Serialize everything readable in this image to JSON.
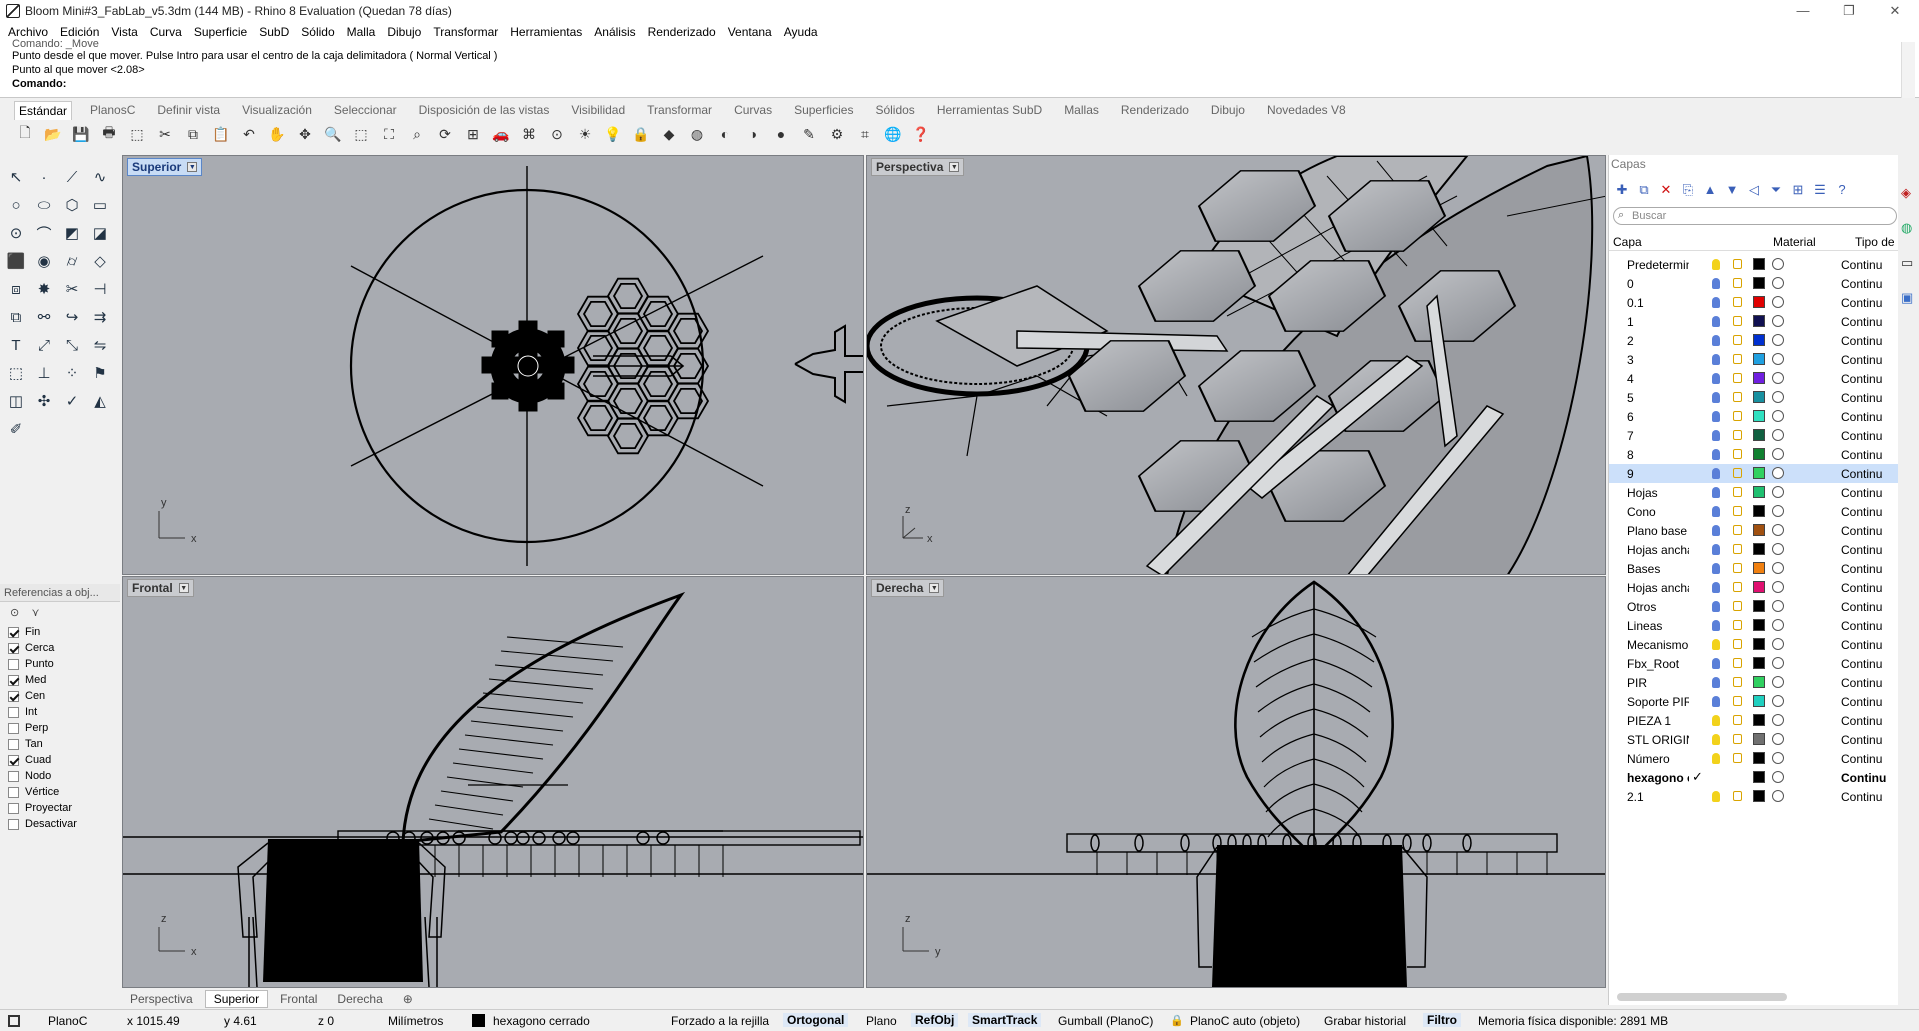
{
  "window": {
    "title": "Bloom Mini#3_FabLab_v5.3dm (144 MB) - Rhino 8 Evaluation (Quedan 78 días)"
  },
  "menu": [
    "Archivo",
    "Edición",
    "Vista",
    "Curva",
    "Superficie",
    "SubD",
    "Sólido",
    "Malla",
    "Dibujo",
    "Transformar",
    "Herramientas",
    "Análisis",
    "Renderizado",
    "Ventana",
    "Ayuda"
  ],
  "command": {
    "history": [
      "Comando: _Move",
      "Punto desde el que mover. Pulse Intro para usar el centro de la caja delimitadora ( Normal  Vertical )",
      "Punto al que mover <2.08>"
    ],
    "prompt": "Comando:"
  },
  "toolbar_tabs": [
    "Estándar",
    "PlanosC",
    "Definir vista",
    "Visualización",
    "Seleccionar",
    "Disposición de las vistas",
    "Visibilidad",
    "Transformar",
    "Curvas",
    "Superficies",
    "Sólidos",
    "Herramientas SubD",
    "Mallas",
    "Renderizado",
    "Dibujo",
    "Novedades V8"
  ],
  "active_tab": "Estándar",
  "viewports": {
    "top": "Superior",
    "perspective": "Perspectiva",
    "front": "Frontal",
    "right": "Derecha"
  },
  "view_tabs": [
    "Perspectiva",
    "Superior",
    "Frontal",
    "Derecha"
  ],
  "active_view_tab": "Superior",
  "osnap": {
    "title": "Referencias a obj...",
    "items": [
      {
        "label": "Fin",
        "checked": true
      },
      {
        "label": "Cerca",
        "checked": true
      },
      {
        "label": "Punto",
        "checked": false
      },
      {
        "label": "Med",
        "checked": true
      },
      {
        "label": "Cen",
        "checked": true
      },
      {
        "label": "Int",
        "checked": false
      },
      {
        "label": "Perp",
        "checked": false
      },
      {
        "label": "Tan",
        "checked": false
      },
      {
        "label": "Cuad",
        "checked": true
      },
      {
        "label": "Nodo",
        "checked": false
      },
      {
        "label": "Vértice",
        "checked": false
      },
      {
        "label": "Proyectar",
        "checked": false
      },
      {
        "label": "Desactivar",
        "checked": false
      }
    ]
  },
  "layers": {
    "title": "Capas",
    "search_placeholder": "Buscar",
    "columns": {
      "name": "Capa",
      "material": "Material",
      "type": "Tipo de"
    },
    "rows": [
      {
        "name": "Predetermin",
        "color": "#000000",
        "bulb": "#f2d21b",
        "type": "Continu"
      },
      {
        "name": "0",
        "color": "#000000",
        "bulb": "#5a7fd8",
        "type": "Continu"
      },
      {
        "name": "0.1",
        "color": "#e00000",
        "bulb": "#5a7fd8",
        "type": "Continu"
      },
      {
        "name": "1",
        "color": "#101050",
        "bulb": "#5a7fd8",
        "type": "Continu"
      },
      {
        "name": "2",
        "color": "#0030d0",
        "bulb": "#5a7fd8",
        "type": "Continu"
      },
      {
        "name": "3",
        "color": "#20a0e0",
        "bulb": "#5a7fd8",
        "type": "Continu"
      },
      {
        "name": "4",
        "color": "#7020e0",
        "bulb": "#5a7fd8",
        "type": "Continu"
      },
      {
        "name": "5",
        "color": "#1890a0",
        "bulb": "#5a7fd8",
        "type": "Continu"
      },
      {
        "name": "6",
        "color": "#30e0c0",
        "bulb": "#5a7fd8",
        "type": "Continu"
      },
      {
        "name": "7",
        "color": "#106040",
        "bulb": "#5a7fd8",
        "type": "Continu"
      },
      {
        "name": "8",
        "color": "#108030",
        "bulb": "#5a7fd8",
        "type": "Continu"
      },
      {
        "name": "9",
        "color": "#30d060",
        "bulb": "#5a7fd8",
        "type": "Continu",
        "selected": true
      },
      {
        "name": "Hojas",
        "color": "#20c070",
        "bulb": "#5a7fd8",
        "type": "Continu"
      },
      {
        "name": "Cono",
        "color": "#000000",
        "bulb": "#5a7fd8",
        "type": "Continu"
      },
      {
        "name": "Plano base",
        "color": "#a05010",
        "bulb": "#5a7fd8",
        "type": "Continu"
      },
      {
        "name": "Hojas ancha",
        "color": "#000000",
        "bulb": "#5a7fd8",
        "type": "Continu"
      },
      {
        "name": "Bases",
        "color": "#f08010",
        "bulb": "#5a7fd8",
        "type": "Continu"
      },
      {
        "name": "Hojas ancha",
        "color": "#e01070",
        "bulb": "#5a7fd8",
        "type": "Continu"
      },
      {
        "name": "Otros",
        "color": "#000000",
        "bulb": "#5a7fd8",
        "type": "Continu"
      },
      {
        "name": "Lineas",
        "color": "#000000",
        "bulb": "#5a7fd8",
        "type": "Continu"
      },
      {
        "name": "Mecanismo",
        "color": "#000000",
        "bulb": "#f2d21b",
        "type": "Continu"
      },
      {
        "name": "Fbx_Root",
        "color": "#000000",
        "bulb": "#5a7fd8",
        "type": "Continu"
      },
      {
        "name": "PIR",
        "color": "#30d060",
        "bulb": "#5a7fd8",
        "type": "Continu"
      },
      {
        "name": "Soporte PIR",
        "color": "#20d0c0",
        "bulb": "#5a7fd8",
        "type": "Continu"
      },
      {
        "name": "PIEZA 1",
        "color": "#000000",
        "bulb": "#f2d21b",
        "type": "Continu"
      },
      {
        "name": "STL ORIGIN.",
        "color": "#707070",
        "bulb": "#f2d21b",
        "type": "Continu"
      },
      {
        "name": "Número",
        "color": "#000000",
        "bulb": "#f2d21b",
        "type": "Continu"
      },
      {
        "name": "hexagono c",
        "color": "#000000",
        "bulb": "#ffffff",
        "type": "Continu",
        "current": true
      },
      {
        "name": "2.1",
        "color": "#000000",
        "bulb": "#f2d21b",
        "type": "Continu"
      }
    ]
  },
  "status": {
    "cplane": "PlanoC",
    "x": "x 1015.49",
    "y": "y 4.61",
    "z": "z 0",
    "units": "Milímetros",
    "layer": "hexagono cerrado",
    "grid": "Forzado a la rejilla",
    "ortho": "Ortogonal",
    "planar": "Plano",
    "osnap": "RefObj",
    "smarttrack": "SmartTrack",
    "gumball": "Gumball (PlanoC)",
    "autocplane": "PlanoC auto (objeto)",
    "history": "Grabar historial",
    "filter": "Filtro",
    "memory": "Memoria física disponible: 2891 MB"
  },
  "colors": {
    "viewport_bg": "#a8abb1",
    "accent": "#3a6ec8",
    "selected_row": "#cce0fa"
  },
  "axes": {
    "x": "x",
    "y": "y",
    "z": "z"
  }
}
